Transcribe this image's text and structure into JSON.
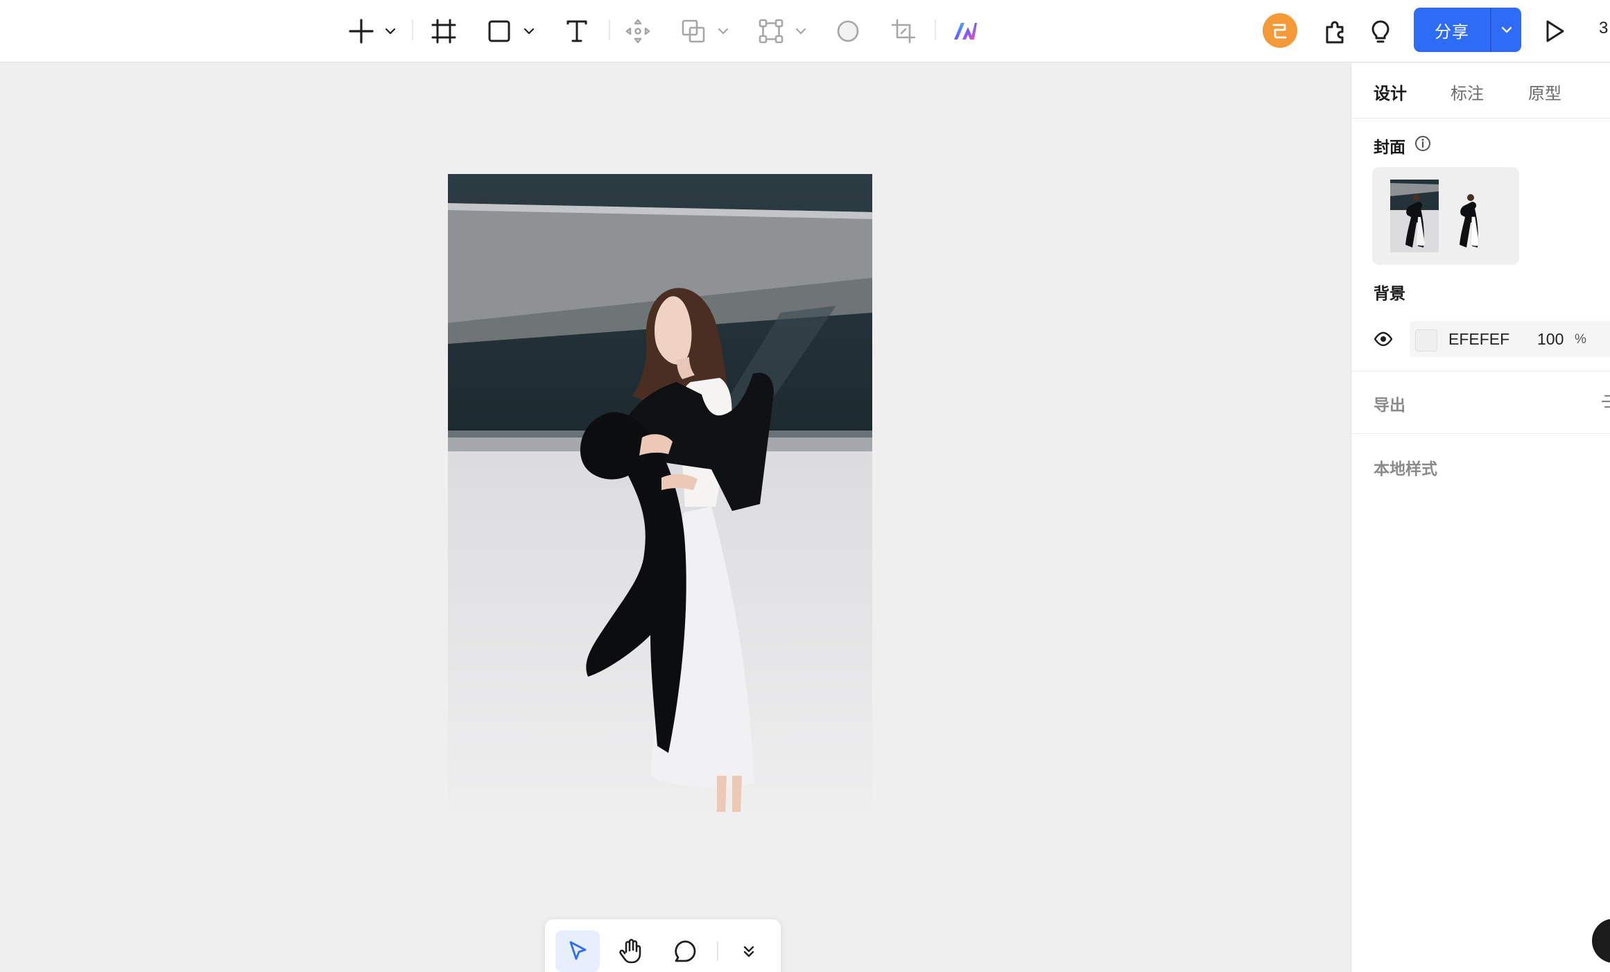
{
  "toolbar": {
    "share_label": "分享",
    "zoom": "3",
    "avatar_initial": "已"
  },
  "panel": {
    "tabs": [
      {
        "label": "设计",
        "active": true
      },
      {
        "label": "标注",
        "active": false
      },
      {
        "label": "原型",
        "active": false
      }
    ],
    "cover": {
      "title": "封面"
    },
    "background": {
      "title": "背景",
      "color_hex": "EFEFEF",
      "opacity": "100",
      "opacity_unit": "%",
      "swatch_color": "#EFEFEF"
    },
    "export": {
      "title": "导出"
    },
    "local_styles": {
      "title": "本地样式"
    }
  },
  "colors": {
    "accent": "#2F6CF6",
    "avatar": "#F59A38",
    "canvas": "#EFEFEF"
  }
}
